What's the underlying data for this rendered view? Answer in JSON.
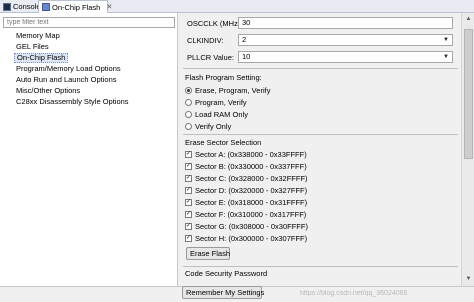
{
  "tabs": [
    {
      "label": "Console",
      "icon": "console-icon"
    },
    {
      "label": "On-Chip Flash",
      "icon": "flash-icon",
      "close": "✕"
    }
  ],
  "filter": {
    "placeholder": "type filter text"
  },
  "nav": {
    "items": [
      {
        "label": "Memory Map"
      },
      {
        "label": "GEL Files"
      },
      {
        "label": "On-Chip Flash"
      },
      {
        "label": "Program/Memory Load Options"
      },
      {
        "label": "Auto Run and Launch Options"
      },
      {
        "label": "Misc/Other Options"
      },
      {
        "label": "C28xx Disassembly Style Options"
      }
    ],
    "selected": "On-Chip Flash"
  },
  "settings": {
    "oscclk": {
      "label": "OSCCLK (MHz):",
      "value": "30"
    },
    "clkindiv": {
      "label": "CLKINDIV:",
      "value": "2"
    },
    "pllcr": {
      "label": "PLLCR Value:",
      "value": "10"
    }
  },
  "flash_program": {
    "label": "Flash Program Setting:",
    "options": [
      {
        "label": "Erase, Program, Verify",
        "selected": true
      },
      {
        "label": "Program, Verify",
        "selected": false
      },
      {
        "label": "Load RAM Only",
        "selected": false
      },
      {
        "label": "Verify Only",
        "selected": false
      }
    ]
  },
  "erase_sectors": {
    "label": "Erase Sector Selection",
    "sectors": [
      {
        "label": "Sector A: (0x338000 - 0x33FFFF)",
        "checked": true
      },
      {
        "label": "Sector B: (0x330000 - 0x337FFF)",
        "checked": true
      },
      {
        "label": "Sector C: (0x328000 - 0x32FFFF)",
        "checked": true
      },
      {
        "label": "Sector D: (0x320000 - 0x327FFF)",
        "checked": true
      },
      {
        "label": "Sector E: (0x318000 - 0x31FFFF)",
        "checked": true
      },
      {
        "label": "Sector F: (0x310000 - 0x317FFF)",
        "checked": true
      },
      {
        "label": "Sector G: (0x308000 - 0x30FFFF)",
        "checked": true
      },
      {
        "label": "Sector H: (0x300000 - 0x307FFF)",
        "checked": true
      }
    ],
    "check_mark": "✓",
    "erase_button": "Erase Flash"
  },
  "code_security": {
    "label": "Code Security Password"
  },
  "remember_button": "Remember My Settings",
  "watermark": "https://blog.csdn.net/qq_36024066",
  "glyphs": {
    "dropdown": "▼",
    "scroll_up": "▲",
    "scroll_down": "▼"
  }
}
